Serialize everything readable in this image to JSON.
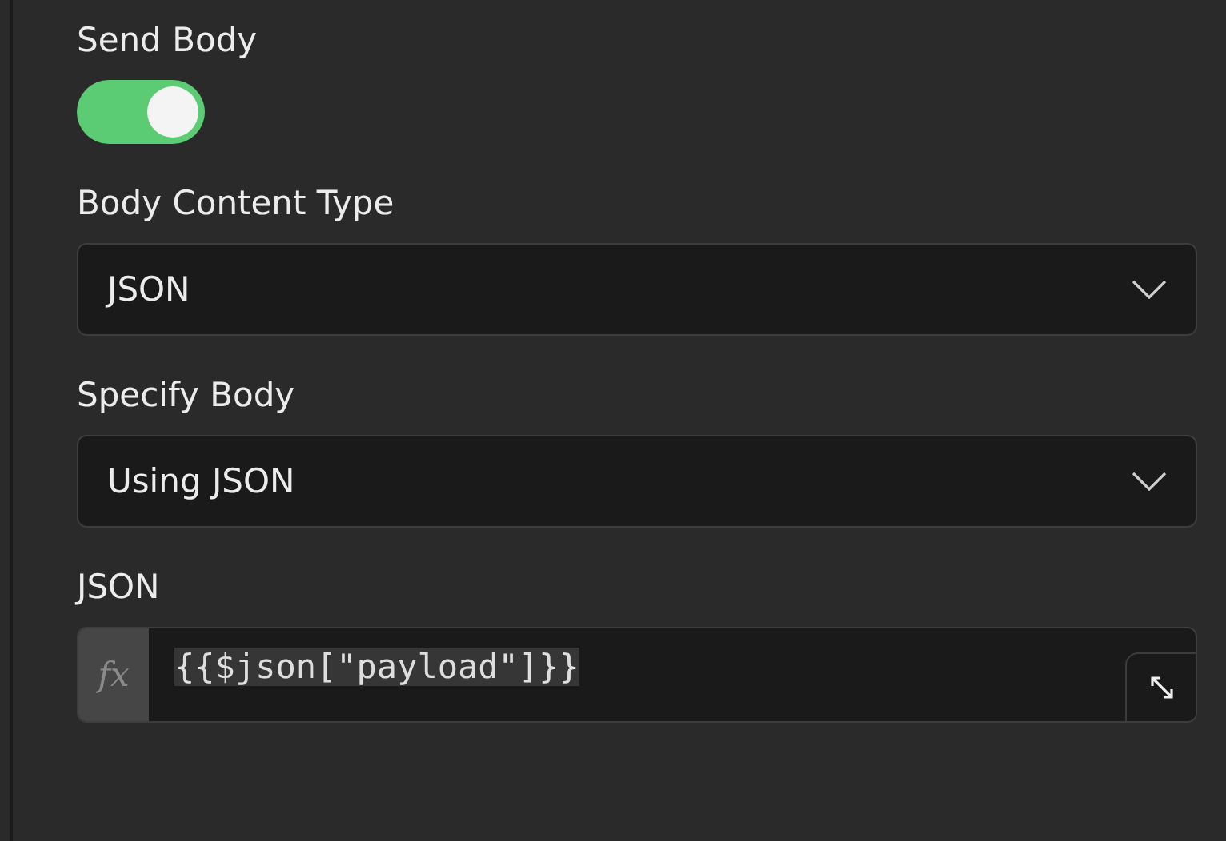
{
  "fields": [
    {
      "kind": "toggle",
      "label": "Send Body",
      "on": true
    },
    {
      "kind": "select",
      "label": "Body Content Type",
      "value": "JSON"
    },
    {
      "kind": "select",
      "label": "Specify Body",
      "value": "Using JSON"
    },
    {
      "kind": "expression",
      "label": "JSON",
      "prefix": "fx",
      "value": "{{$json[\"payload\"]}}"
    }
  ]
}
